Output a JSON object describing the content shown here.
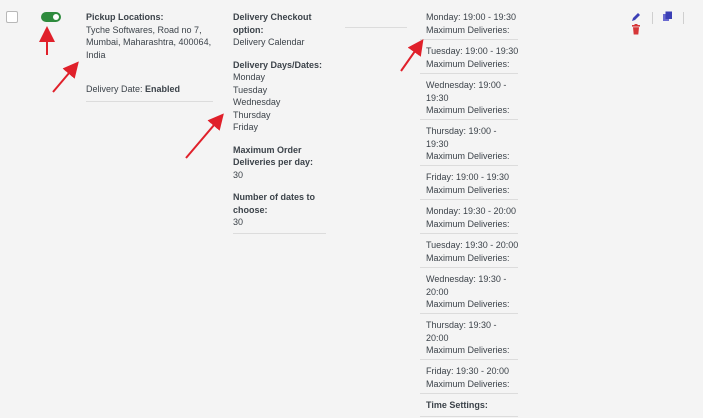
{
  "row": {
    "pickup": {
      "heading": "Pickup Locations:",
      "address_lines": [
        "Tyche Softwares, Road no 7,",
        "Mumbai, Maharashtra, 400064,",
        "India"
      ],
      "delivery_date_label": "Delivery Date:",
      "delivery_date_value": "Enabled"
    },
    "settings": {
      "checkout_heading": [
        "Delivery Checkout",
        "option:"
      ],
      "checkout_value": "Delivery Calendar",
      "days_heading": "Delivery Days/Dates:",
      "days": [
        "Monday",
        "Tuesday",
        "Wednesday",
        "Thursday",
        "Friday"
      ],
      "max_heading": [
        "Maximum Order",
        "Deliveries per day:"
      ],
      "max_value": "30",
      "dates_heading": [
        "Number of dates to",
        "choose:"
      ],
      "dates_value": "30"
    },
    "slots": [
      {
        "lines": [
          "Monday: 19:00 - 19:30"
        ],
        "max": "Maximum Deliveries:"
      },
      {
        "lines": [
          "Tuesday: 19:00 - 19:30"
        ],
        "max": "Maximum Deliveries:"
      },
      {
        "lines": [
          "Wednesday: 19:00 -",
          "19:30"
        ],
        "max": "Maximum Deliveries:"
      },
      {
        "lines": [
          "Thursday: 19:00 -",
          "19:30"
        ],
        "max": "Maximum Deliveries:"
      },
      {
        "lines": [
          "Friday: 19:00 - 19:30"
        ],
        "max": "Maximum Deliveries:"
      },
      {
        "lines": [
          "Monday: 19:30 - 20:00"
        ],
        "max": "Maximum Deliveries:"
      },
      {
        "lines": [
          "Tuesday: 19:30 - 20:00"
        ],
        "max": "Maximum Deliveries:"
      },
      {
        "lines": [
          "Wednesday: 19:30 -",
          "20:00"
        ],
        "max": "Maximum Deliveries:"
      },
      {
        "lines": [
          "Thursday: 19:30 -",
          "20:00"
        ],
        "max": "Maximum Deliveries:"
      },
      {
        "lines": [
          "Friday: 19:30 - 20:00"
        ],
        "max": "Maximum Deliveries:"
      }
    ],
    "time_settings_label": "Time Settings:",
    "actions": {
      "edit_icon": "pencil-icon",
      "copy_icon": "copy-icon",
      "delete_icon": "trash-icon"
    }
  },
  "colors": {
    "toggle_on": "#2e8b3d",
    "edit": "#3b3fb5",
    "copy": "#3b3fb5",
    "delete": "#d63638",
    "arrow": "#e0202a"
  }
}
